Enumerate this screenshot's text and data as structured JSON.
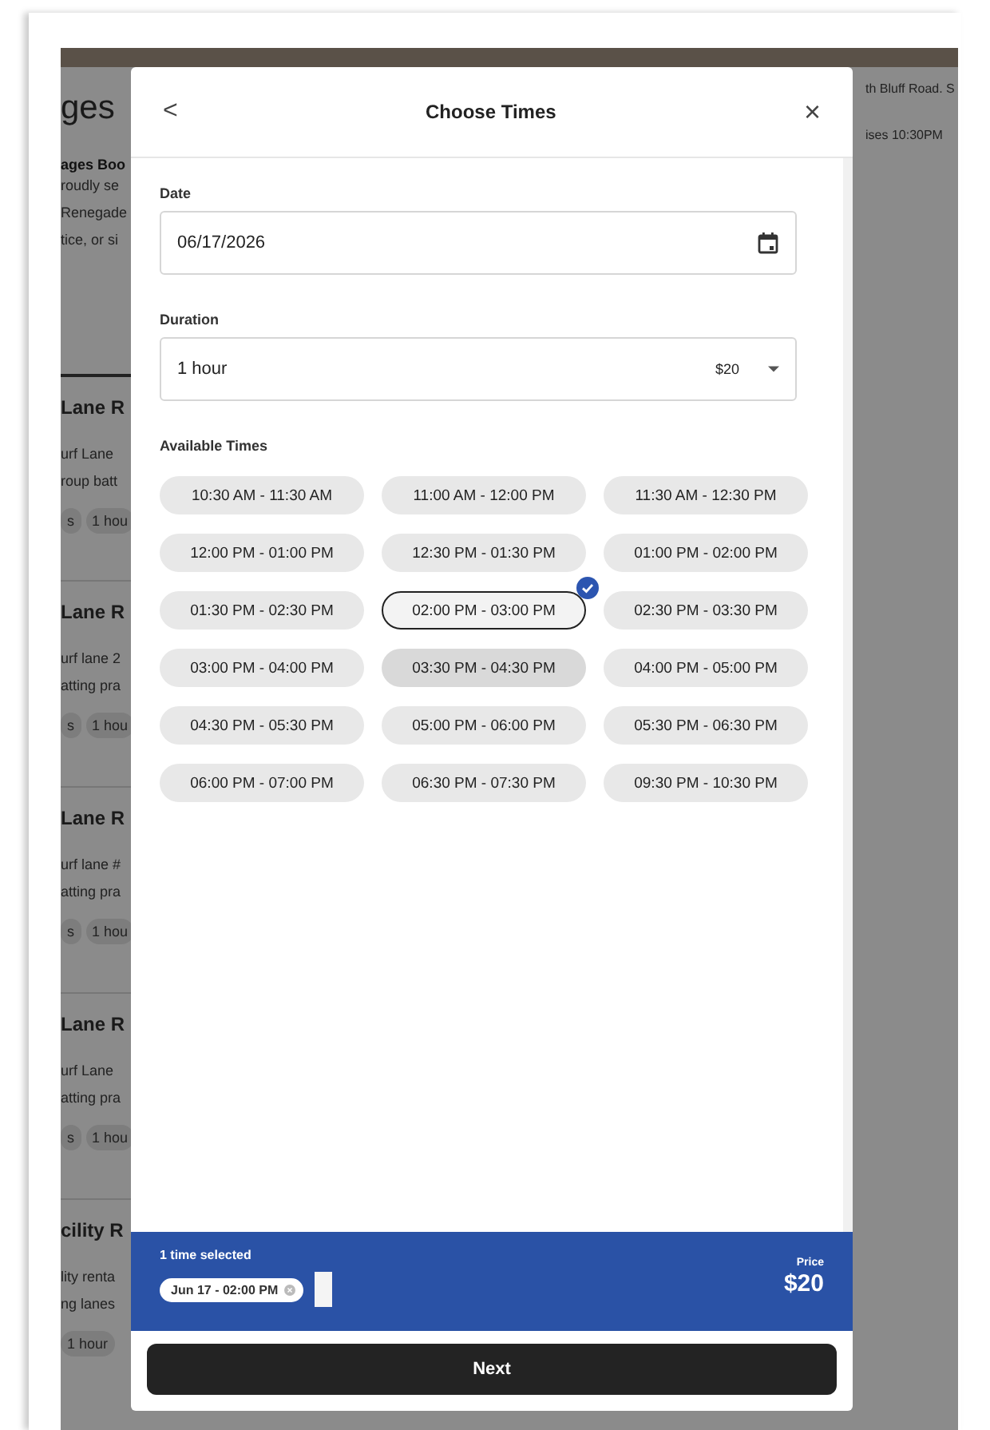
{
  "background_page": {
    "title": "ges",
    "address": "th Bluff Road. S",
    "hours": "ises 10:30PM",
    "intro_heading": "ages Boo",
    "intro_lines": [
      "roudly se",
      "Renegade",
      "tice, or si"
    ],
    "cards": [
      {
        "title": "Lane R",
        "lines": [
          "urf Lane",
          "roup batt"
        ],
        "tags": [
          "s",
          "1 hou"
        ]
      },
      {
        "title": "Lane R",
        "lines": [
          "urf lane 2",
          "atting pra"
        ],
        "tags": [
          "s",
          "1 hou"
        ]
      },
      {
        "title": "Lane R",
        "lines": [
          "urf lane #",
          "atting pra"
        ],
        "tags": [
          "s",
          "1 hou"
        ]
      },
      {
        "title": "Lane R",
        "lines": [
          "urf Lane",
          "atting pra"
        ],
        "tags": [
          "s",
          "1 hou"
        ]
      },
      {
        "title": "cility R",
        "lines": [
          "lity renta",
          "ng lanes"
        ],
        "tags": [
          "1 hour"
        ]
      }
    ]
  },
  "dialog": {
    "title": "Choose Times",
    "back": "<",
    "close": "×",
    "date": {
      "label": "Date",
      "value": "06/17/2026"
    },
    "duration": {
      "label": "Duration",
      "value": "1 hour",
      "price": "$20"
    },
    "times_label": "Available Times",
    "times": [
      {
        "label": "10:30 AM - 11:30 AM",
        "selected": false,
        "hovered": false
      },
      {
        "label": "11:00 AM - 12:00 PM",
        "selected": false,
        "hovered": false
      },
      {
        "label": "11:30 AM - 12:30 PM",
        "selected": false,
        "hovered": false
      },
      {
        "label": "12:00 PM - 01:00 PM",
        "selected": false,
        "hovered": false
      },
      {
        "label": "12:30 PM - 01:30 PM",
        "selected": false,
        "hovered": false
      },
      {
        "label": "01:00 PM - 02:00 PM",
        "selected": false,
        "hovered": false
      },
      {
        "label": "01:30 PM - 02:30 PM",
        "selected": false,
        "hovered": false
      },
      {
        "label": "02:00 PM - 03:00 PM",
        "selected": true,
        "hovered": false
      },
      {
        "label": "02:30 PM - 03:30 PM",
        "selected": false,
        "hovered": false
      },
      {
        "label": "03:00 PM - 04:00 PM",
        "selected": false,
        "hovered": false
      },
      {
        "label": "03:30 PM - 04:30 PM",
        "selected": false,
        "hovered": true
      },
      {
        "label": "04:00 PM - 05:00 PM",
        "selected": false,
        "hovered": false
      },
      {
        "label": "04:30 PM - 05:30 PM",
        "selected": false,
        "hovered": false
      },
      {
        "label": "05:00 PM - 06:00 PM",
        "selected": false,
        "hovered": false
      },
      {
        "label": "05:30 PM - 06:30 PM",
        "selected": false,
        "hovered": false
      },
      {
        "label": "06:00 PM - 07:00 PM",
        "selected": false,
        "hovered": false
      },
      {
        "label": "06:30 PM - 07:30 PM",
        "selected": false,
        "hovered": false
      },
      {
        "label": "09:30 PM - 10:30 PM",
        "selected": false,
        "hovered": false
      }
    ],
    "summary": {
      "count": "1 time selected",
      "chips": [
        "Jun 17 - 02:00 PM"
      ],
      "price_label": "Price",
      "price": "$20"
    },
    "next": "Next"
  }
}
